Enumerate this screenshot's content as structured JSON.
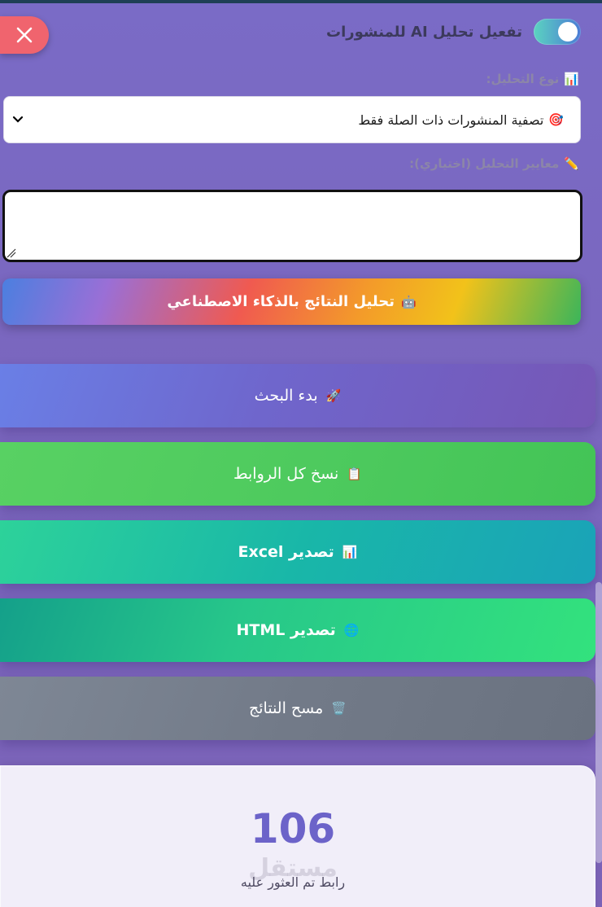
{
  "ai_toggle": {
    "label": "تفعيل تحليل AI للمنشورات",
    "enabled": true
  },
  "analysis_type": {
    "icon": "📊",
    "label": "نوع التحليل:",
    "selected_icon": "🎯",
    "selected": "تصفية المنشورات ذات الصلة فقط"
  },
  "criteria": {
    "icon": "✏️",
    "label": "معايير التحليل (اختياري):",
    "value": ""
  },
  "ai_button": {
    "icon": "🤖",
    "label": "تحليل النتائج بالذكاء الاصطناعي"
  },
  "actions": {
    "start": {
      "icon": "🚀",
      "label": "بدء البحث"
    },
    "copy": {
      "icon": "📋",
      "label": "نسخ كل الروابط"
    },
    "excel": {
      "icon": "📊",
      "label": "تصدير Excel"
    },
    "html": {
      "icon": "🌐",
      "label": "تصدير HTML"
    },
    "clear": {
      "icon": "🗑️",
      "label": "مسح النتائج"
    }
  },
  "stats": {
    "count": "106",
    "label": "رابط تم العثور عليه",
    "watermark": "مستقل"
  },
  "colors": {
    "close": "#f0646e",
    "accent": "#6c63c9"
  }
}
